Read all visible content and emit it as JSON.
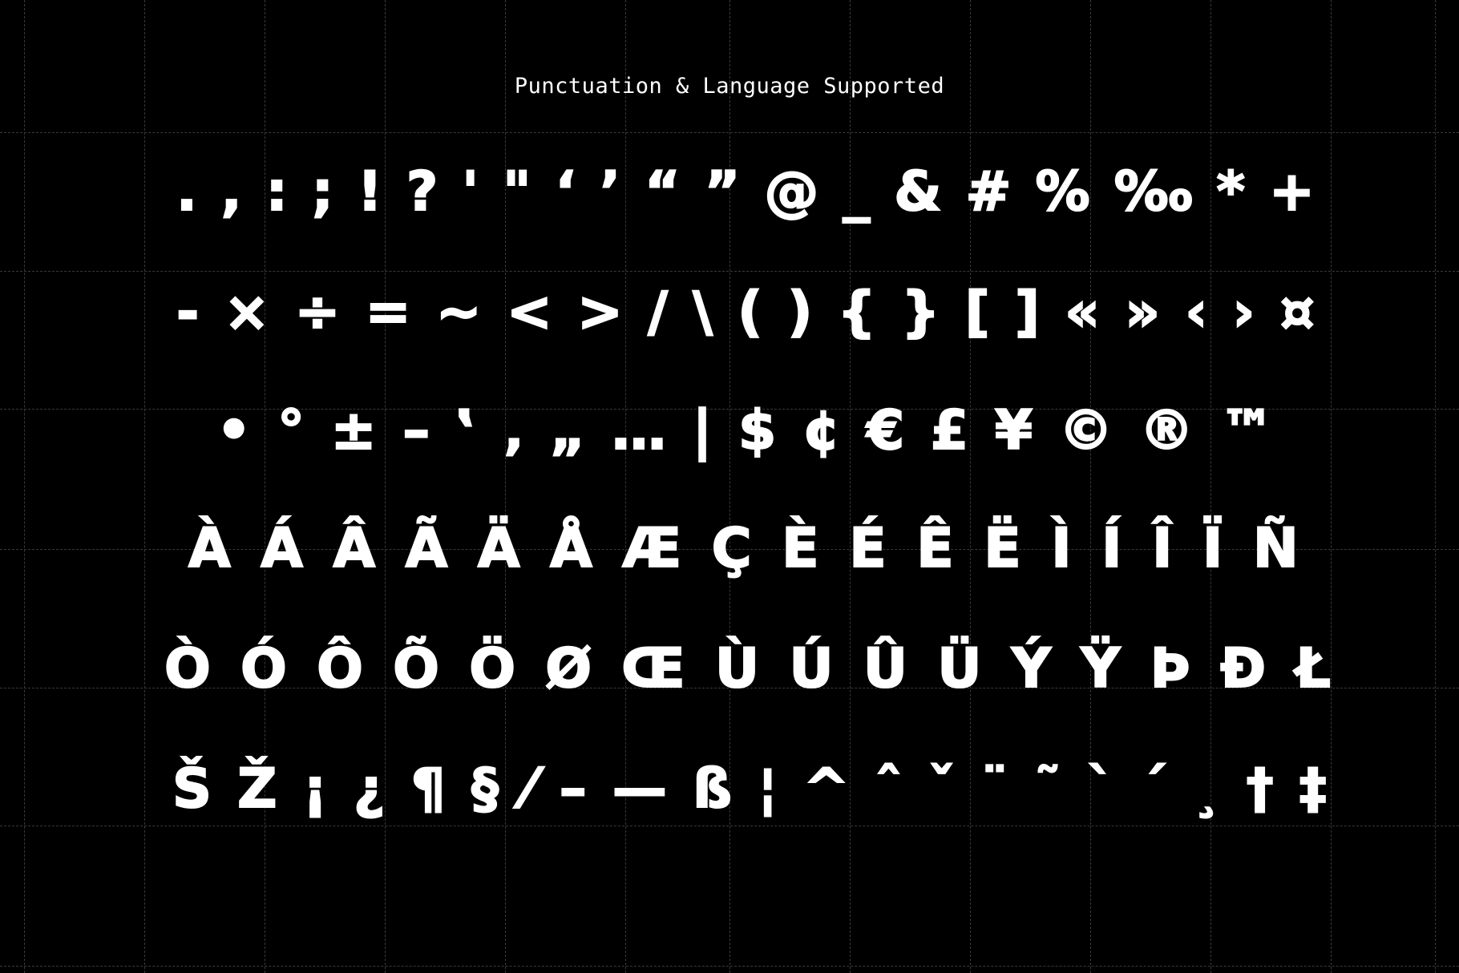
{
  "title": "Punctuation & Language Supported",
  "rows": [
    [
      ".",
      ",",
      ":",
      ";",
      "!",
      "?",
      "'",
      "\"",
      "‘",
      "’",
      "“",
      "”",
      "@",
      "_",
      "&",
      "#",
      "%",
      "‰",
      "*",
      "+"
    ],
    [
      "-",
      "×",
      "÷",
      "=",
      "~",
      "<",
      ">",
      "/",
      "\\",
      "(",
      ")",
      "{",
      "}",
      "[",
      "]",
      "«",
      "»",
      "‹",
      "›",
      "¤"
    ],
    [
      "•",
      "°",
      "±",
      "–",
      "‛",
      "‚",
      "„",
      "…",
      "|",
      "$",
      "¢",
      "€",
      "£",
      "¥",
      "©",
      "®",
      "™"
    ],
    [
      "À",
      "Á",
      "Â",
      "Ã",
      "Ä",
      "Å",
      "Æ",
      "Ç",
      "È",
      "É",
      "Ê",
      "Ë",
      "Ì",
      "Í",
      "Î",
      "Ï",
      "Ñ"
    ],
    [
      "Ò",
      "Ó",
      "Ô",
      "Õ",
      "Ö",
      "Ø",
      "Œ",
      "Ù",
      "Ú",
      "Û",
      "Ü",
      "Ý",
      "Ÿ",
      "Þ",
      "Ð",
      "Ł"
    ],
    [
      "Š",
      "Ž",
      "¡",
      "¿",
      "¶",
      "§",
      "⁄",
      "–",
      "—",
      "ß",
      "¦",
      "^",
      "ˆ",
      "ˇ",
      "¨",
      "˜",
      "`",
      "´",
      "¸",
      "†",
      "‡"
    ]
  ]
}
